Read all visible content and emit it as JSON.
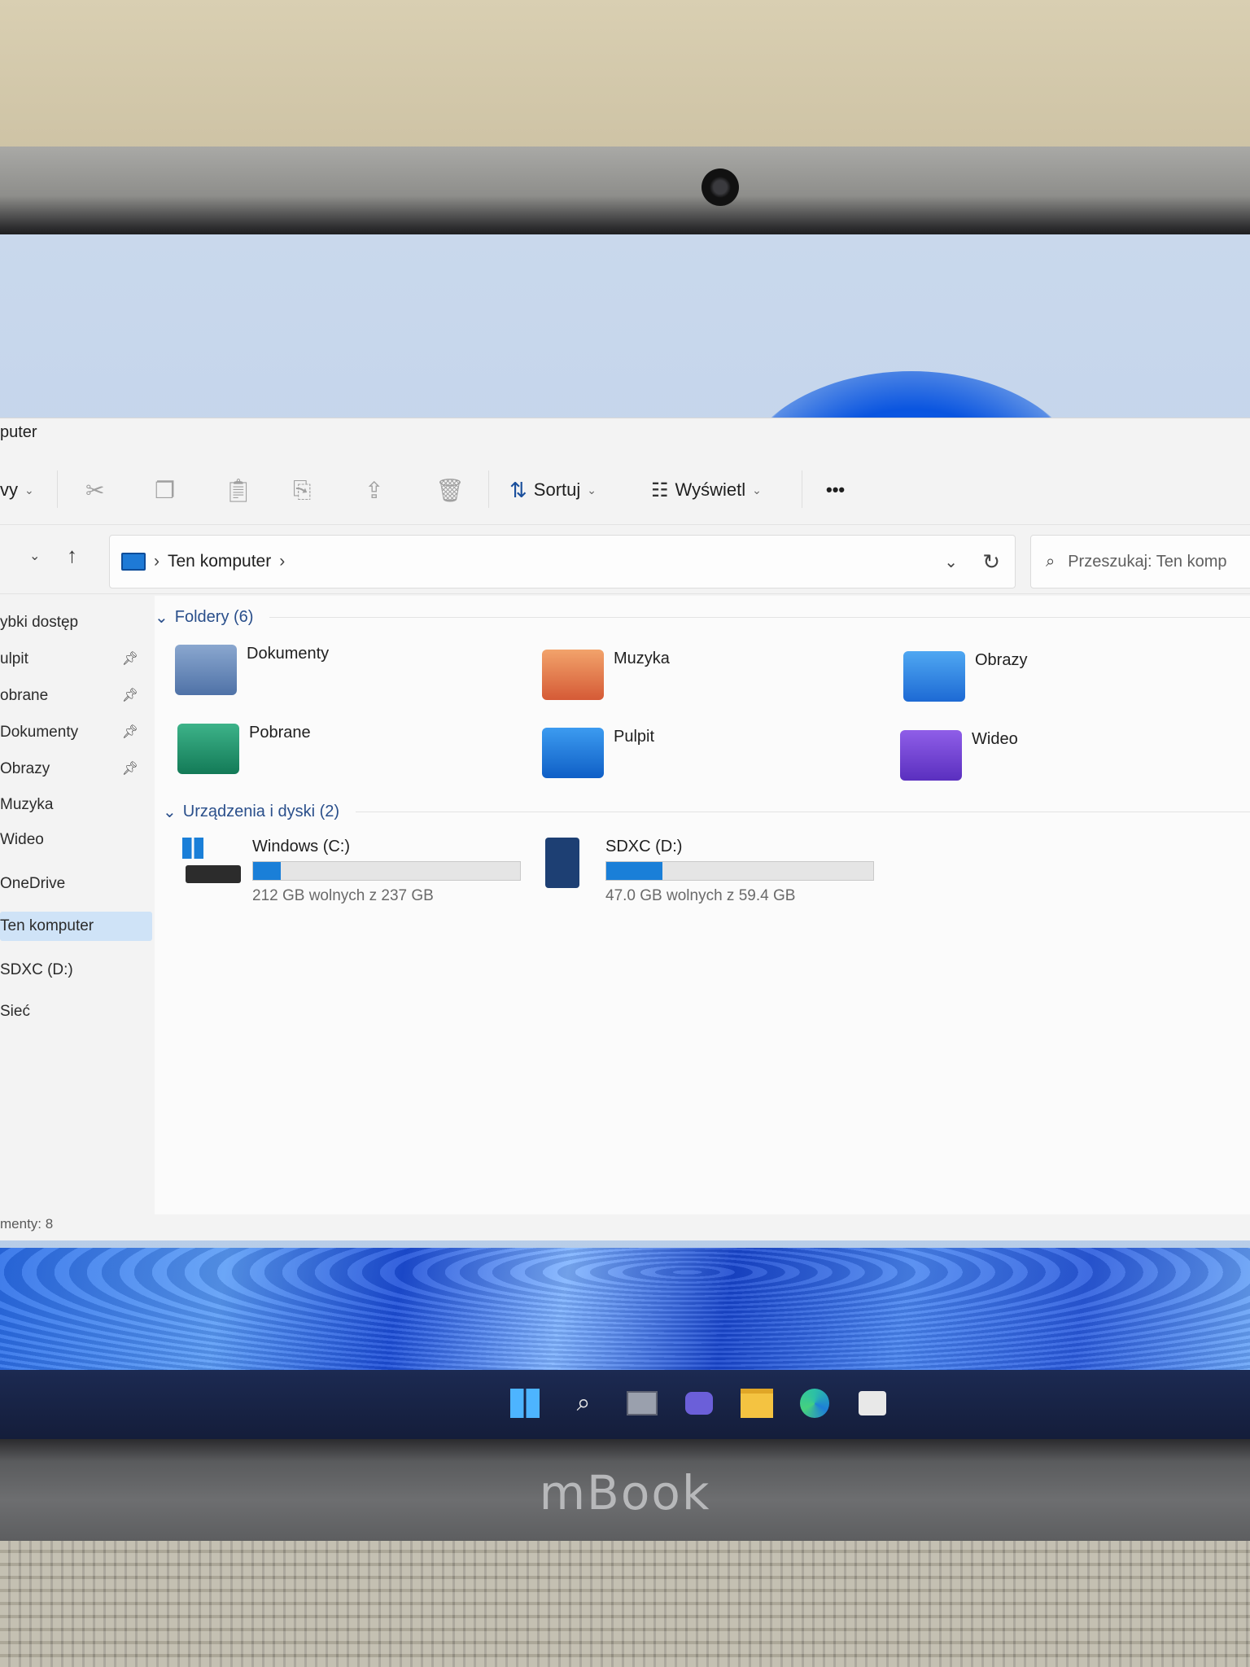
{
  "window": {
    "title": "puter"
  },
  "toolbar": {
    "new_partial": "vy",
    "sort_label": "Sortuj",
    "view_label": "Wyświetl",
    "more_label": "•••"
  },
  "address": {
    "crumb": "Ten komputer",
    "search_placeholder": "Przeszukaj: Ten komp"
  },
  "nav": {
    "items": [
      {
        "label": "ybki dostęp"
      },
      {
        "label": "ulpit"
      },
      {
        "label": "obrane"
      },
      {
        "label": "Dokumenty"
      },
      {
        "label": "Obrazy"
      },
      {
        "label": "Muzyka"
      },
      {
        "label": "Wideo"
      },
      {
        "label": "OneDrive"
      },
      {
        "label": "Ten komputer"
      },
      {
        "label": "SDXC (D:)"
      },
      {
        "label": "Sieć"
      }
    ]
  },
  "sections": {
    "folders": "Foldery (6)",
    "drives": "Urządzenia i dyski (2)"
  },
  "folders": [
    {
      "label": "Dokumenty",
      "icon": "documents-folder-icon"
    },
    {
      "label": "Muzyka",
      "icon": "music-folder-icon"
    },
    {
      "label": "Obrazy",
      "icon": "pictures-folder-icon"
    },
    {
      "label": "Pobrane",
      "icon": "downloads-folder-icon"
    },
    {
      "label": "Pulpit",
      "icon": "desktop-folder-icon"
    },
    {
      "label": "Wideo",
      "icon": "videos-folder-icon"
    }
  ],
  "drives": [
    {
      "label": "Windows (C:)",
      "free": "212 GB wolnych z 237 GB",
      "used_fraction": 0.105
    },
    {
      "label": "SDXC (D:)",
      "free": "47.0 GB wolnych z 59.4 GB",
      "used_fraction": 0.209
    }
  ],
  "status": {
    "items": "menty: 8"
  },
  "brand": "mBook",
  "colors": {
    "accent": "#1a7fd8",
    "taskbar": "#141d3a"
  }
}
